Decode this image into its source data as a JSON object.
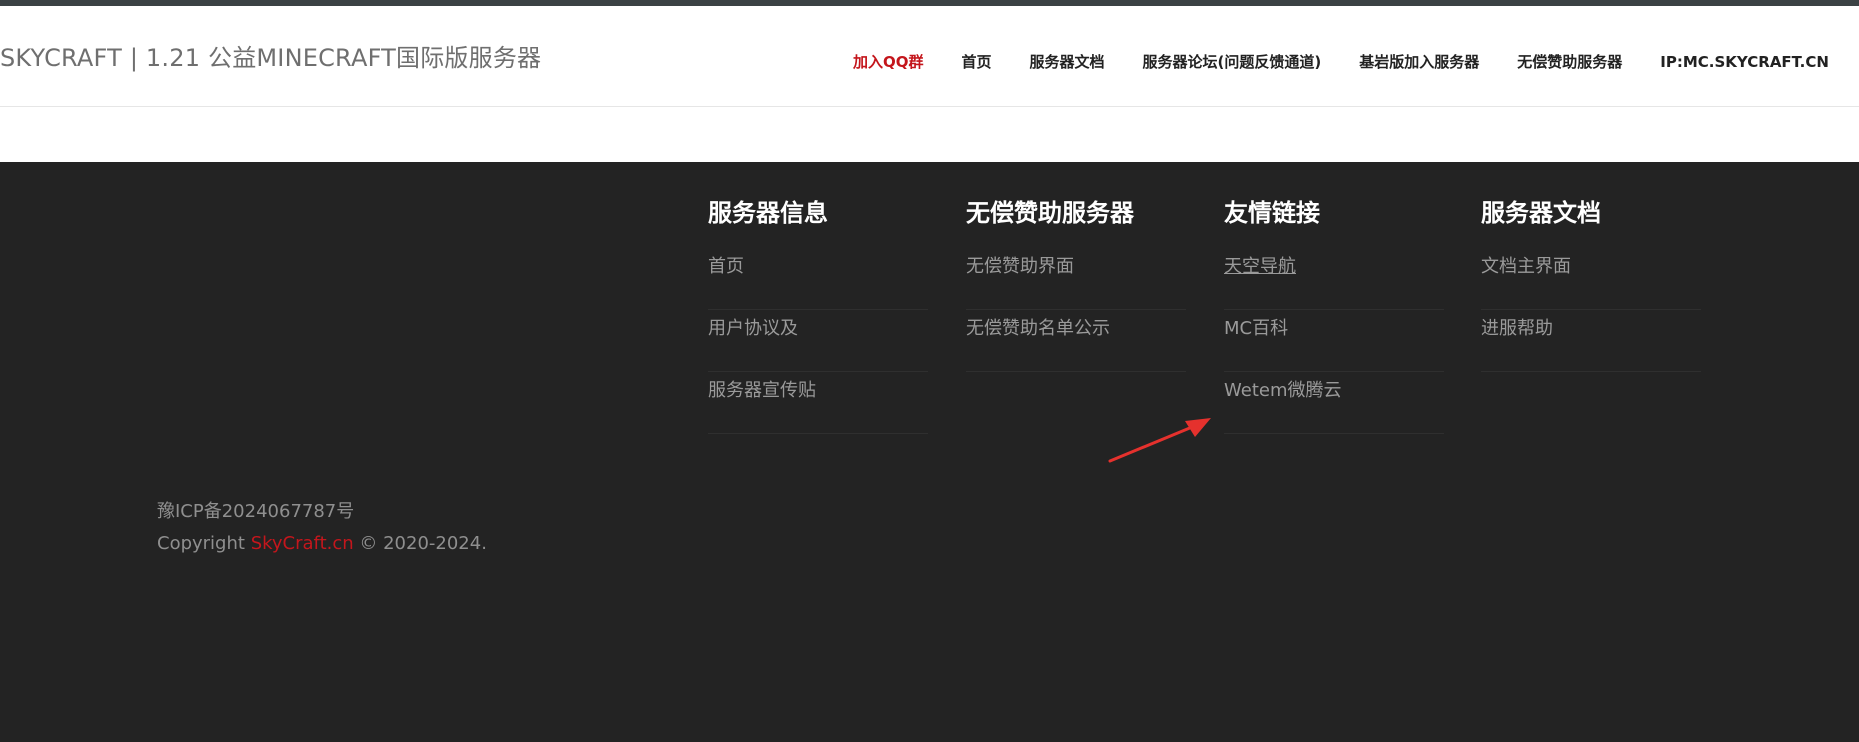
{
  "header": {
    "site_title": "SKYCRAFT | 1.21 公益MINECRAFT国际版服务器",
    "nav": [
      {
        "label": "加入QQ群",
        "active": true
      },
      {
        "label": "首页"
      },
      {
        "label": "服务器文档"
      },
      {
        "label": "服务器论坛(问题反馈通道)"
      },
      {
        "label": "基岩版加入服务器"
      },
      {
        "label": "无偿赞助服务器"
      },
      {
        "label": "IP:MC.SKYCRAFT.CN"
      }
    ]
  },
  "footer": {
    "columns": [
      {
        "title": "服务器信息",
        "links": [
          "首页",
          "用户协议及",
          "服务器宣传贴"
        ]
      },
      {
        "title": "无偿赞助服务器",
        "links": [
          "无偿赞助界面",
          "无偿赞助名单公示"
        ]
      },
      {
        "title": "友情链接",
        "links": [
          "天空导航",
          "MC百科",
          "Wetem微腾云"
        ]
      },
      {
        "title": "服务器文档",
        "links": [
          "文档主界面",
          "进服帮助"
        ]
      }
    ],
    "icp": "豫ICP备2024067787号",
    "copyright_prefix": "Copyright ",
    "copyright_brand": "SkyCraft.cn",
    "copyright_suffix": " © 2020-2024."
  },
  "colors": {
    "accent": "#c4161c",
    "footer_bg": "#232323",
    "annotation_arrow": "#e5312d"
  }
}
